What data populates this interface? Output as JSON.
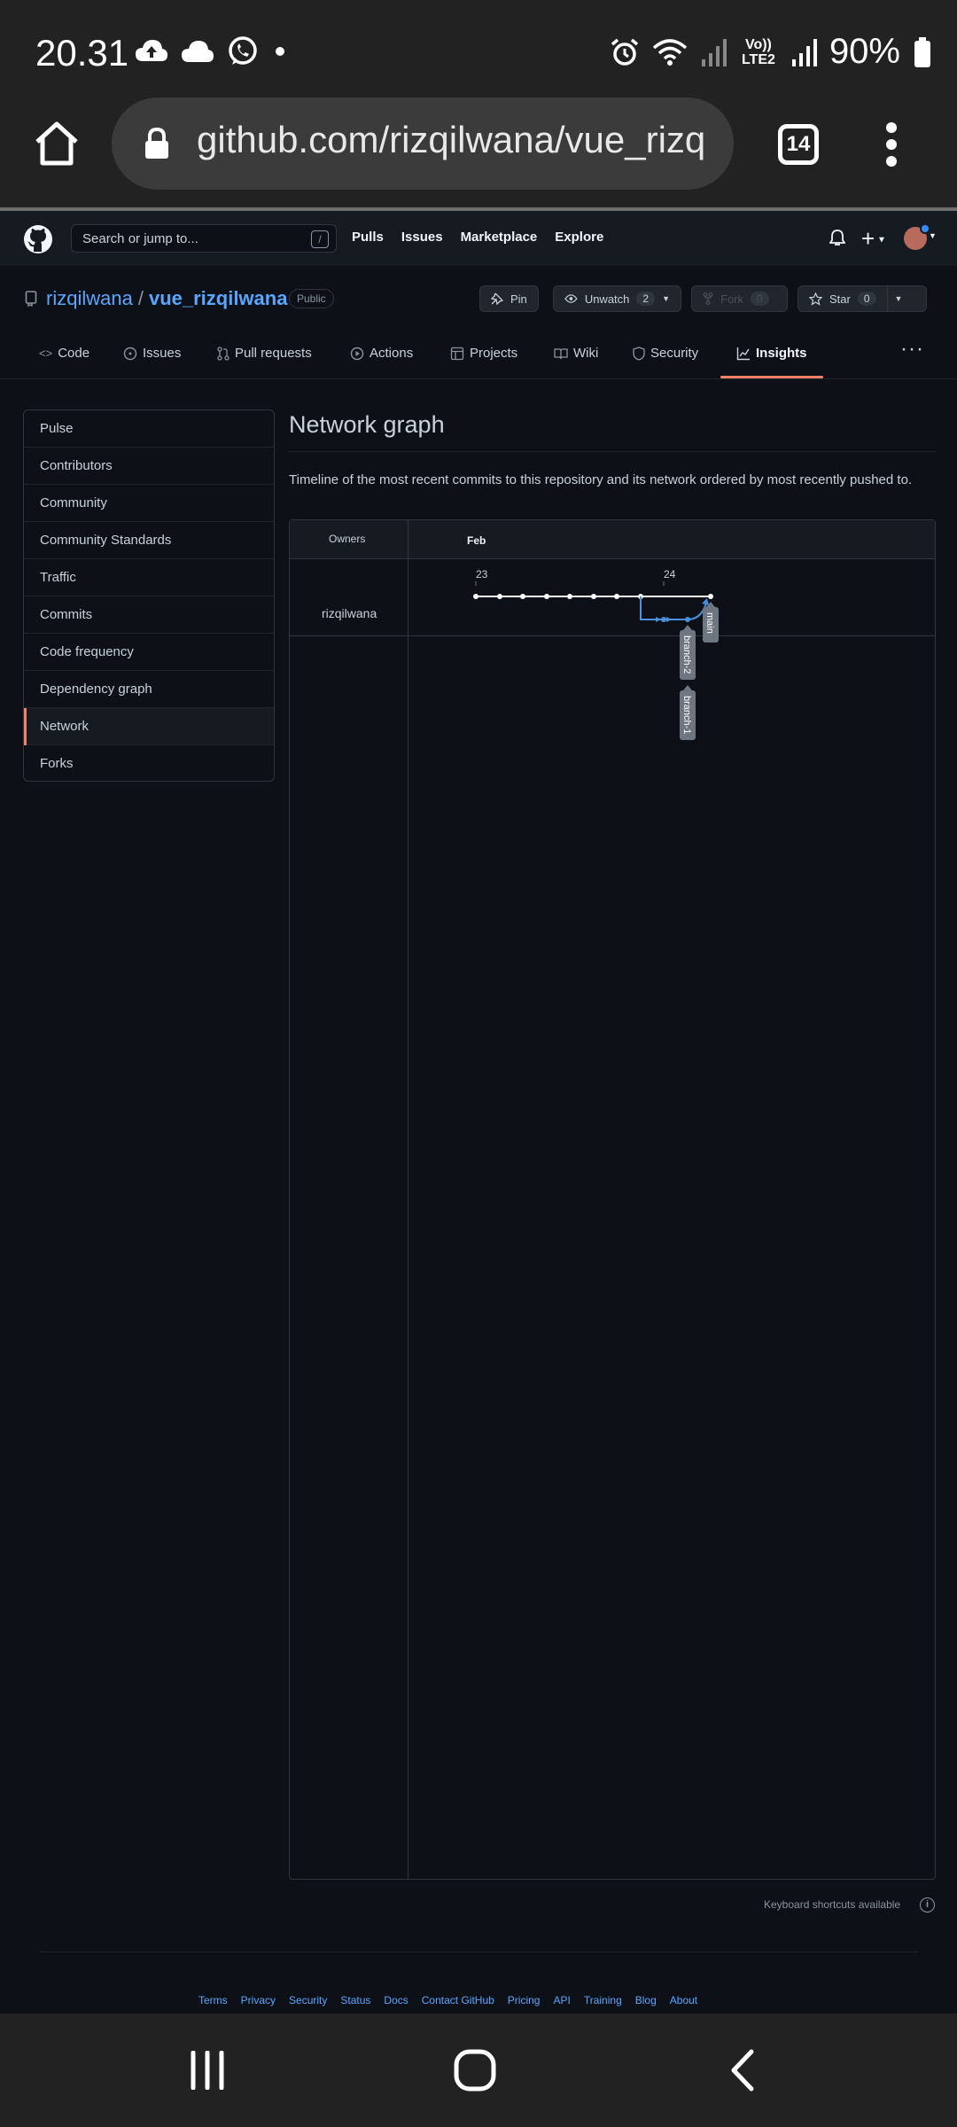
{
  "status_bar": {
    "time": "20.31",
    "network_label": "Vo)) LTE2",
    "battery": "90%"
  },
  "browser": {
    "url": "github.com/rizqilwana/vue_rizq",
    "tab_count": "14"
  },
  "gh_header": {
    "search_placeholder": "Search or jump to...",
    "search_shortcut": "/",
    "nav": [
      "Pulls",
      "Issues",
      "Marketplace",
      "Explore"
    ]
  },
  "repo": {
    "owner": "rizqilwana",
    "separator": "/",
    "name": "vue_rizqilwana",
    "visibility": "Public",
    "pin_label": "Pin",
    "unwatch_label": "Unwatch",
    "unwatch_count": "2",
    "fork_label": "Fork",
    "fork_count": "0",
    "star_label": "Star",
    "star_count": "0",
    "tabs": [
      "Code",
      "Issues",
      "Pull requests",
      "Actions",
      "Projects",
      "Wiki",
      "Security",
      "Insights"
    ],
    "more": "···"
  },
  "sidebar": {
    "items": [
      "Pulse",
      "Contributors",
      "Community",
      "Community Standards",
      "Traffic",
      "Commits",
      "Code frequency",
      "Dependency graph",
      "Network",
      "Forks"
    ],
    "active": "Network"
  },
  "main": {
    "title": "Network graph",
    "description": "Timeline of the most recent commits to this repository and its network ordered by most recently pushed to."
  },
  "graph": {
    "owners_header": "Owners",
    "month": "Feb",
    "days": [
      "23",
      "24"
    ],
    "owner": "rizqilwana",
    "branches": [
      "main",
      "branch-2",
      "branch-1"
    ],
    "colors": {
      "main": "#ffffff",
      "branch": "#4a90d9",
      "label_bg": "#6e7681"
    }
  },
  "footer": {
    "keyboard_note": "Keyboard shortcuts available",
    "links": [
      "Terms",
      "Privacy",
      "Security",
      "Status",
      "Docs",
      "Contact GitHub",
      "Pricing",
      "API",
      "Training",
      "Blog",
      "About"
    ]
  }
}
